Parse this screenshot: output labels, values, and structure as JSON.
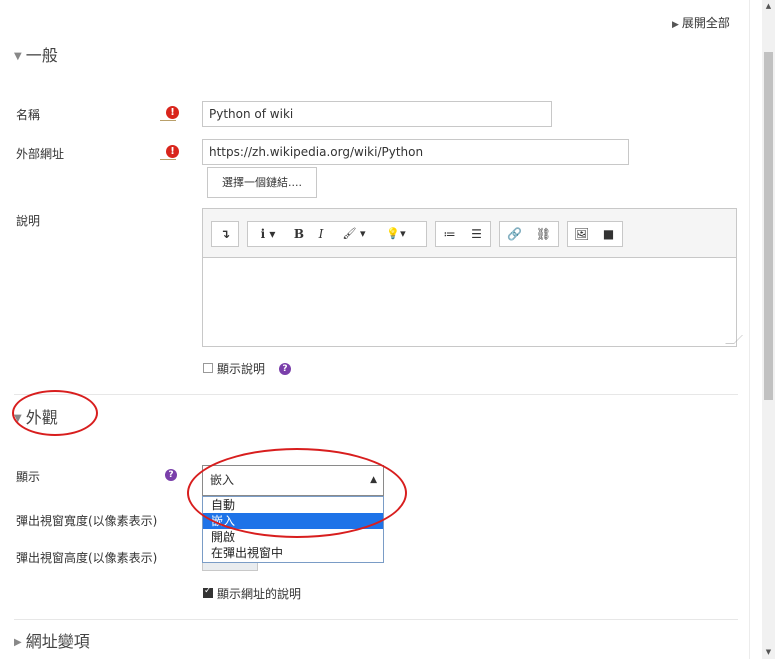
{
  "header": {
    "expand_all": "展開全部"
  },
  "sections": {
    "general": "一般",
    "appearance": "外觀",
    "url_vars": "網址變項"
  },
  "fields": {
    "name": {
      "label": "名稱",
      "value": "Python of wiki"
    },
    "external_url": {
      "label": "外部網址",
      "value": "https://zh.wikipedia.org/wiki/Python",
      "choose_link": "選擇一個鏈結...."
    },
    "description": {
      "label": "說明",
      "show_description": "顯示說明",
      "editor_content": ""
    },
    "display": {
      "label": "顯示",
      "selected": "嵌入",
      "options": [
        "自動",
        "嵌入",
        "開啟",
        "在彈出視窗中"
      ]
    },
    "popup_width": {
      "label": "彈出視窗寬度(以像素表示)"
    },
    "popup_height": {
      "label": "彈出視窗高度(以像素表示)"
    },
    "show_url_description": {
      "label": "顯示網址的說明",
      "checked": true
    }
  },
  "toolbar": {
    "buttons": [
      "collapse-icon",
      "info-icon",
      "bold-icon",
      "italic-icon",
      "brush-icon",
      "lightbulb-icon",
      "bullet-list-icon",
      "numbered-list-icon",
      "link-icon",
      "unlink-icon",
      "image-icon",
      "video-icon"
    ],
    "bold": "B",
    "italic": "I"
  },
  "colors": {
    "required": "#d9251c",
    "help": "#7a3faa",
    "highlight": "#1e73e8",
    "annotation": "#d81e1e"
  }
}
